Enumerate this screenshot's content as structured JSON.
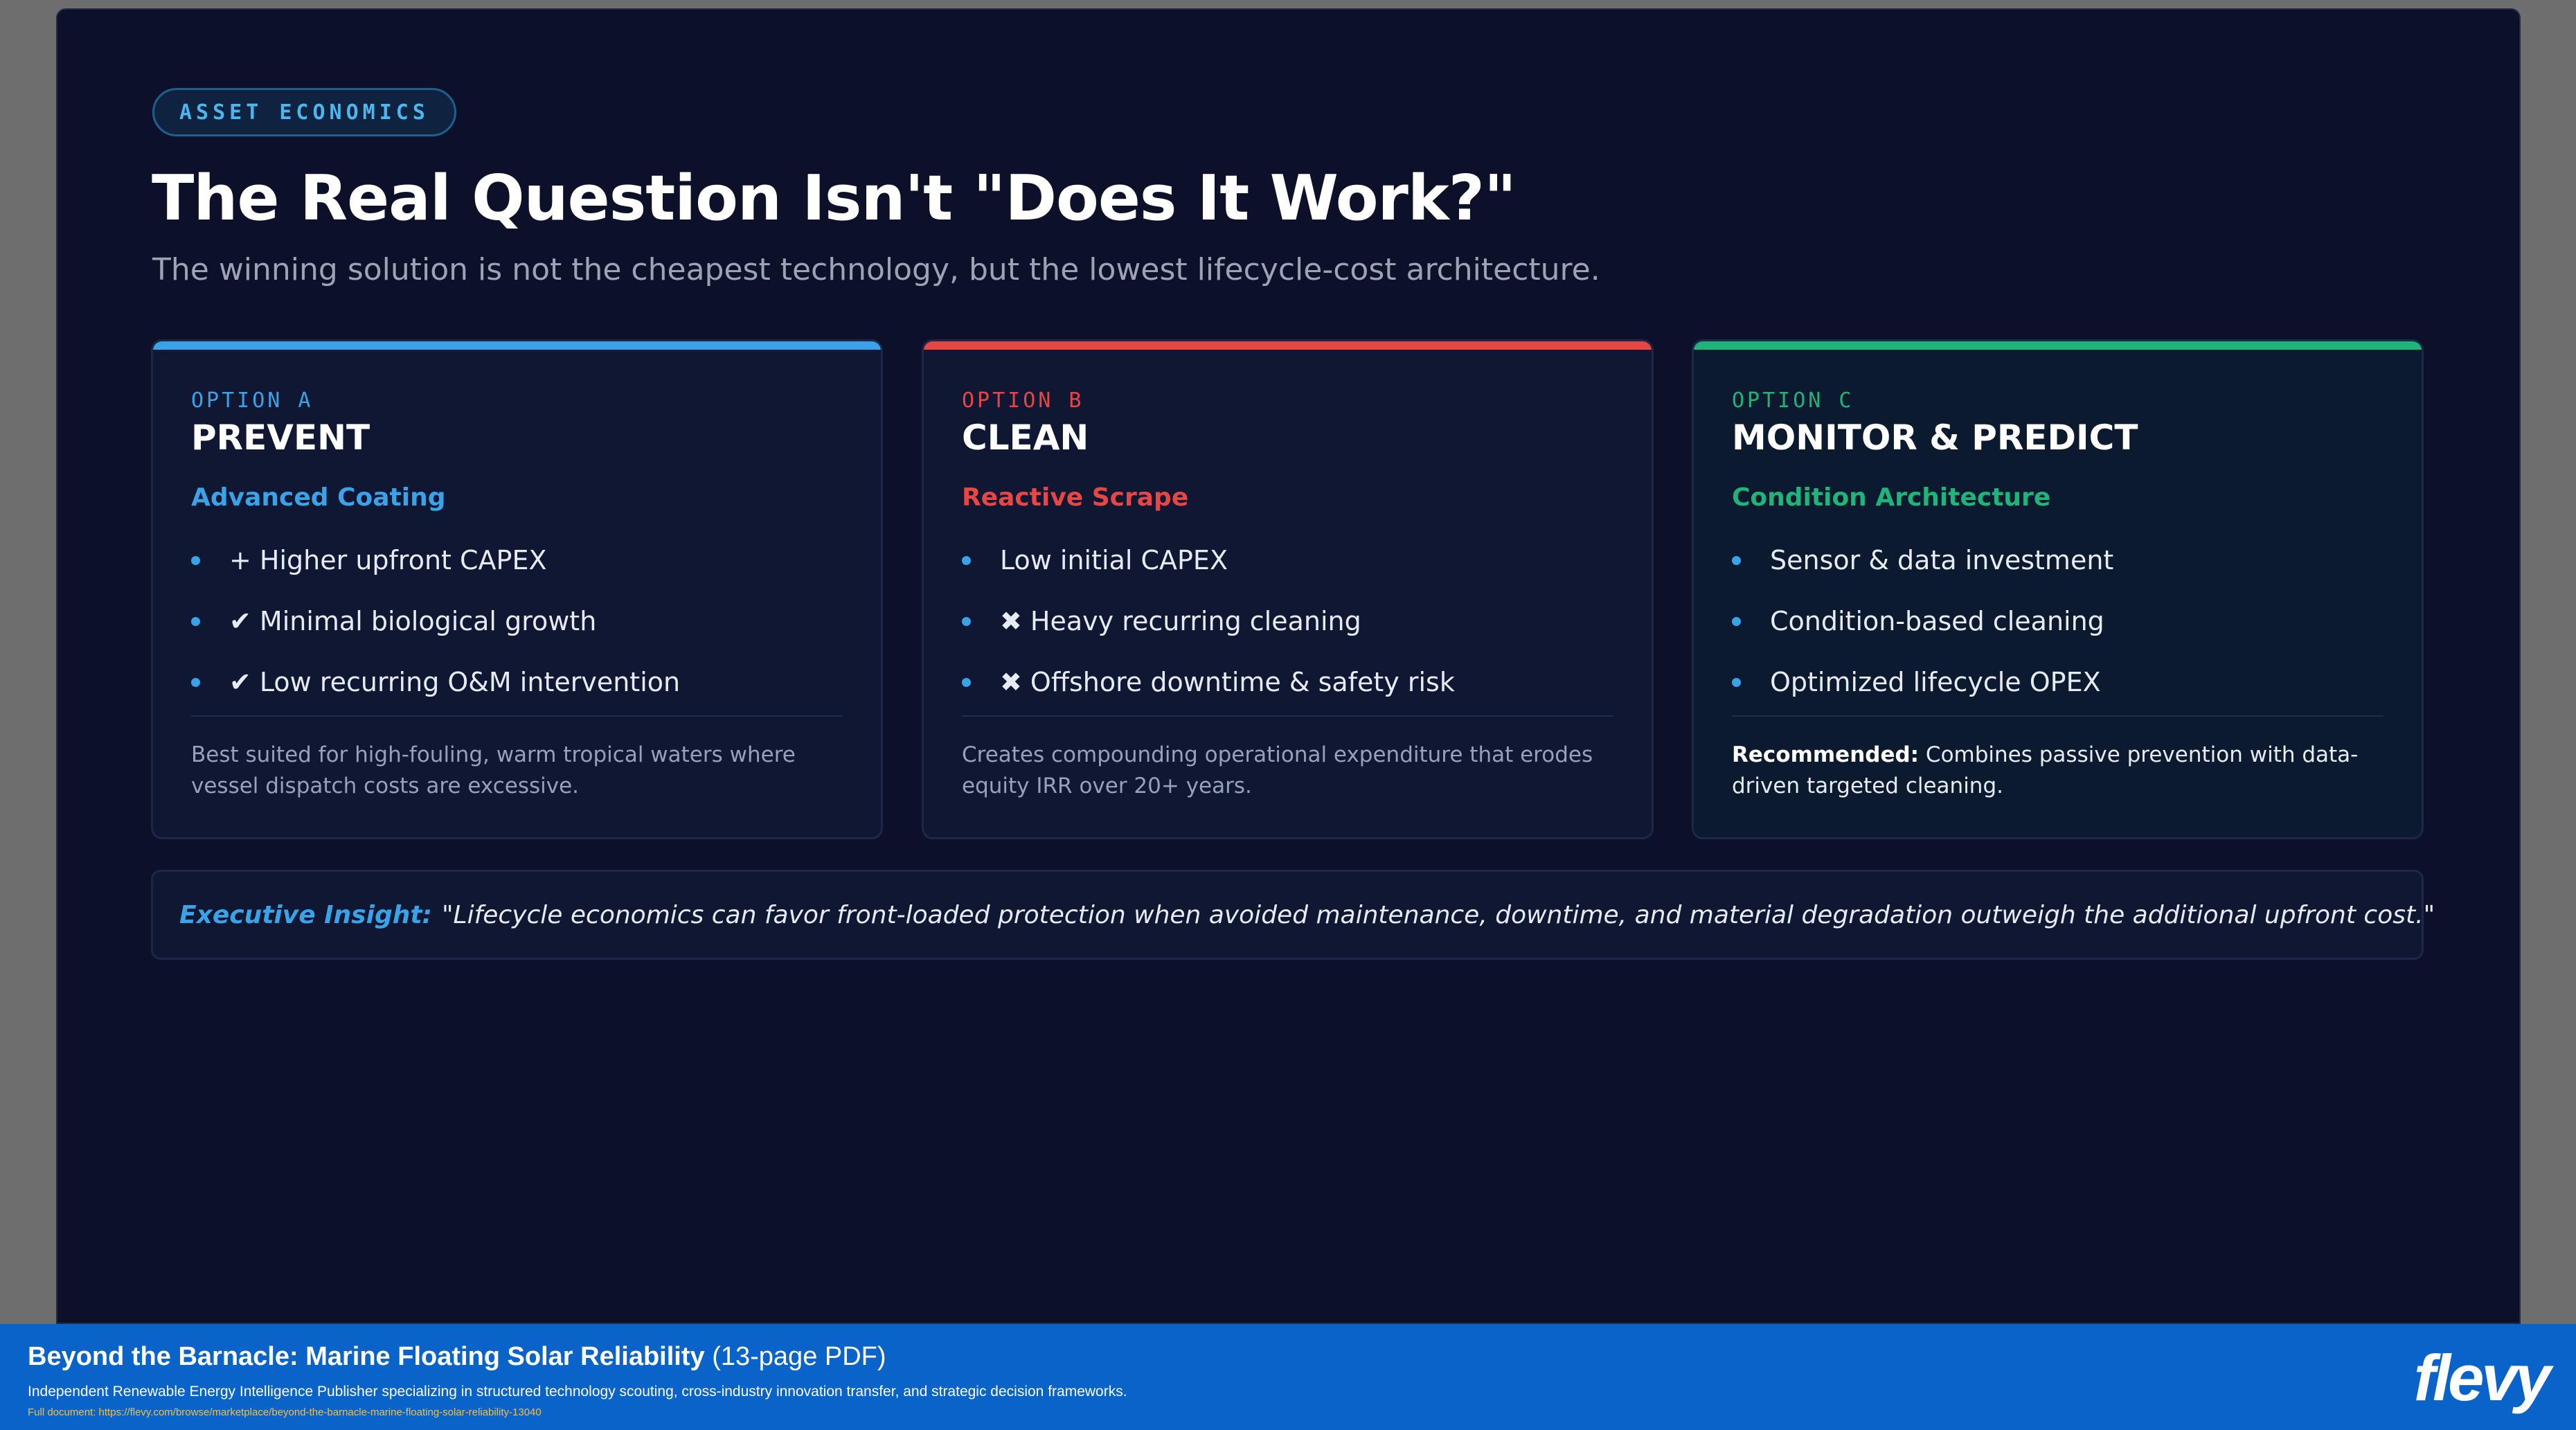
{
  "slide": {
    "tag": "ASSET ECONOMICS",
    "title": "The Real Question Isn't \"Does It Work?\"",
    "subtitle": "The winning solution is not the cheapest technology, but the lowest lifecycle-cost architecture."
  },
  "cards": [
    {
      "option": "OPTION A",
      "name": "PREVENT",
      "subhead": "Advanced Coating",
      "accent": "#3aa3e8",
      "items": [
        "+ Higher upfront CAPEX",
        "✔ Minimal biological growth",
        "✔ Low recurring O&M intervention"
      ],
      "note": "Best suited for high-fouling, warm tropical waters where vessel dispatch costs are excessive."
    },
    {
      "option": "OPTION B",
      "name": "CLEAN",
      "subhead": "Reactive Scrape",
      "accent": "#e84545",
      "items": [
        "Low initial CAPEX",
        "✖ Heavy recurring cleaning",
        "✖ Offshore downtime & safety risk"
      ],
      "note": "Creates compounding operational expenditure that erodes equity IRR over 20+ years."
    },
    {
      "option": "OPTION C",
      "name": "MONITOR & PREDICT",
      "subhead": "Condition Architecture",
      "accent": "#1fb47a",
      "items": [
        "Sensor & data investment",
        "Condition-based cleaning",
        "Optimized lifecycle OPEX"
      ],
      "note_lead": "Recommended:",
      "note": " Combines passive prevention with data-driven targeted cleaning."
    }
  ],
  "insight": {
    "lead": "Executive Insight:",
    "text": "\"Lifecycle economics can favor front-loaded protection when avoided maintenance, downtime, and material degradation outweigh the additional upfront cost.\""
  },
  "footer": {
    "title": "Beyond the Barnacle: Marine Floating Solar Reliability",
    "pages": " (13-page PDF)",
    "description": "Independent Renewable Energy Intelligence Publisher specializing in structured technology scouting, cross-industry innovation transfer, and strategic decision frameworks.",
    "link": "Full document: https://flevy.com/browse/marketplace/beyond-the-barnacle-marine-floating-solar-reliability-13040",
    "logo": "flevy"
  }
}
